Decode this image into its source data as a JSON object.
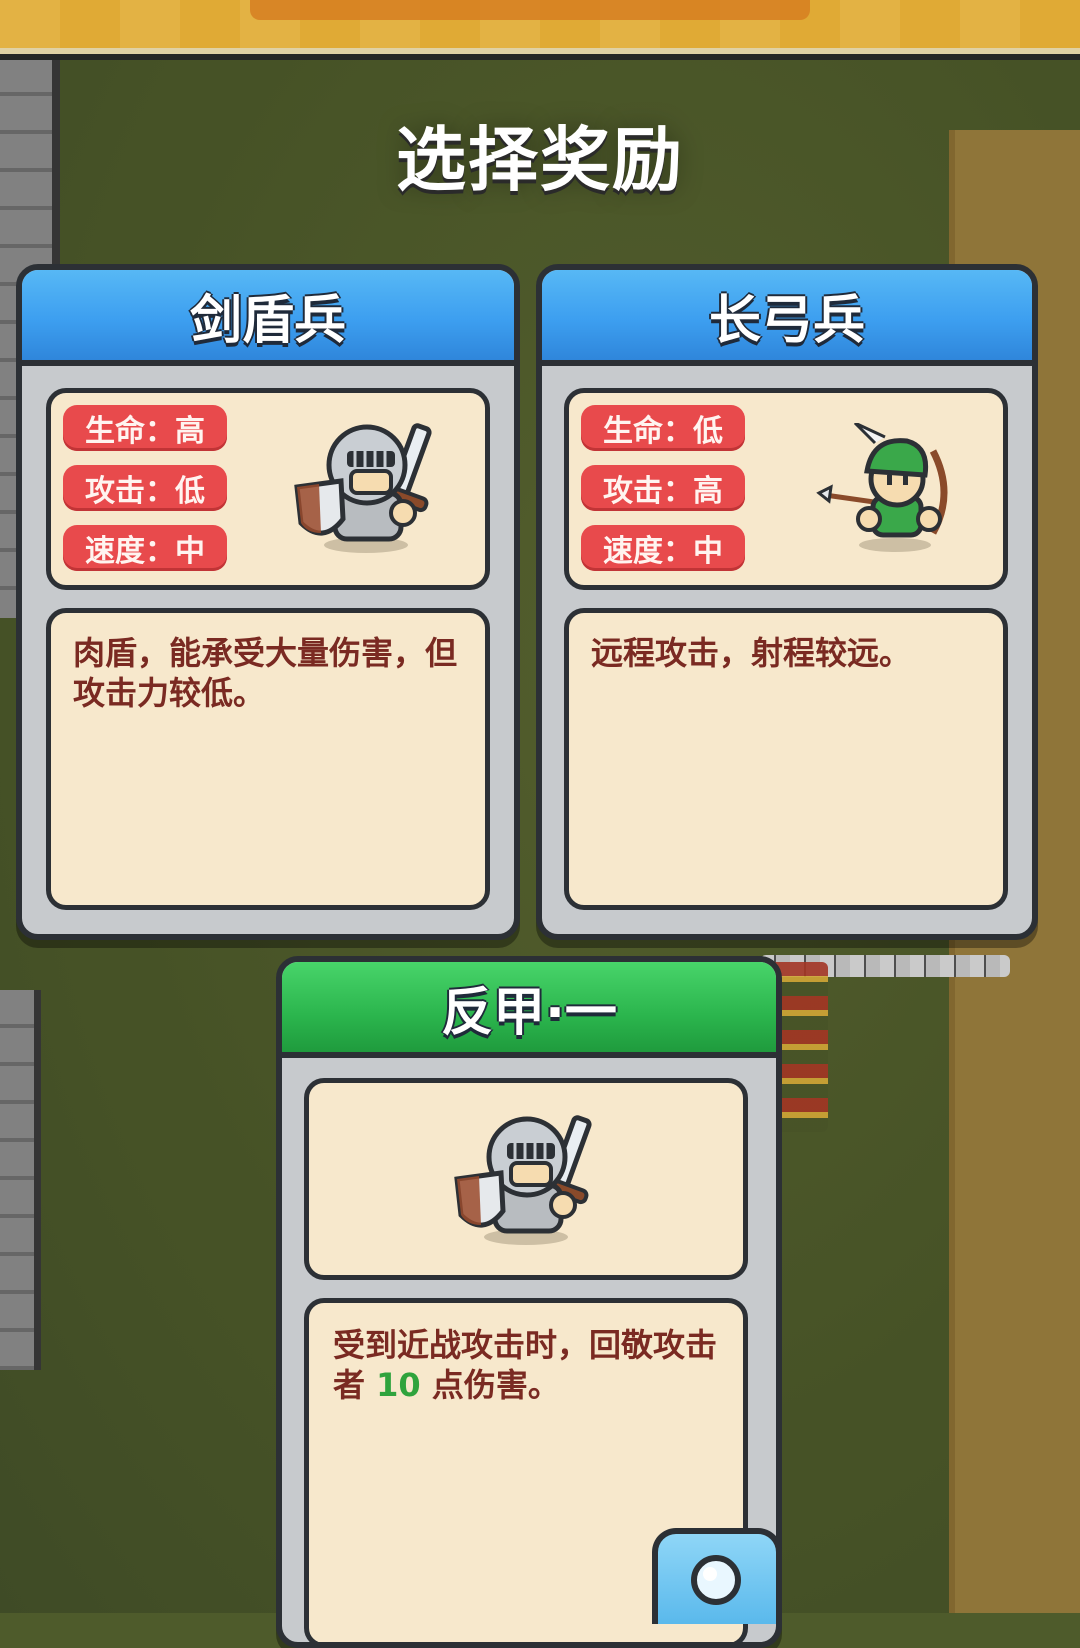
{
  "screen_title": "选择奖励",
  "cards": [
    {
      "name": "剑盾兵",
      "header_color": "#3d9ff0",
      "stats": [
        "生命：高",
        "攻击：低",
        "速度：中"
      ],
      "icon": "sword-shield-knight-icon",
      "description": "肉盾，能承受大量伤害，但攻击力较低。"
    },
    {
      "name": "长弓兵",
      "header_color": "#3d9ff0",
      "stats": [
        "生命：低",
        "攻击：高",
        "速度：中"
      ],
      "icon": "longbow-archer-icon",
      "description": "远程攻击，射程较远。"
    },
    {
      "name": "反甲·一",
      "header_color": "#2bb54d",
      "icon": "sword-shield-knight-icon",
      "description_prefix": "受到近战攻击时，回敬攻击者 ",
      "description_value": "10",
      "description_suffix": " 点伤害。"
    }
  ],
  "colors": {
    "stat_badge": "#e84a4c",
    "panel_bg": "#f7e8cc",
    "description_text": "#7a2a22",
    "highlight_number": "#2fa33d"
  }
}
